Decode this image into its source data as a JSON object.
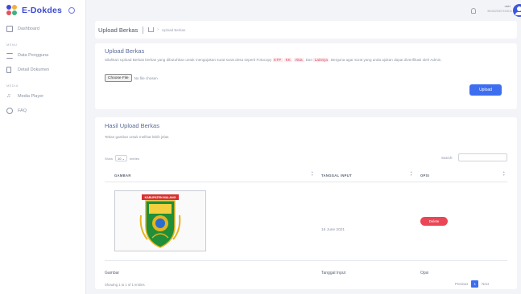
{
  "brand": {
    "title": "E-Dokdes"
  },
  "sidebar": {
    "items": [
      {
        "label": "Dashboard",
        "icon": "monitor-icon"
      },
      {
        "label": "Data Pengguna",
        "icon": "list-icon"
      },
      {
        "label": "Detail Dokumen",
        "icon": "document-icon"
      },
      {
        "label": "Media Player",
        "icon": "music-icon"
      },
      {
        "label": "FAQ",
        "icon": "help-icon"
      }
    ]
  },
  "header": {
    "user_name": "user",
    "user_id": "3515220307190011"
  },
  "breadcrumb": {
    "title": "Upload Berkas",
    "current": "Upload Berkas"
  },
  "upload": {
    "title": "Upload Berkas",
    "desc_before": "Silahkan Upload Berkas berkas yang dibutuhkan untuk mengajukan surat surat desa seperti Fotocopy ",
    "code1": "KTP",
    "sep1": ", ",
    "code2": "KK",
    "sep2": ", ",
    "code3": "Akta",
    "desc_mid": ", Dan ",
    "code4": "Lainnya",
    "desc_after": ". Berguna agar surat yang anda ajukan dapat diverifikasi oleh Admin.",
    "choose_file": "Choose File",
    "no_file": "No file chosen",
    "button": "Upload"
  },
  "results": {
    "title": "Hasil Upload Berkas",
    "hint": "Tekan gambar untuk melihat lebih jelas",
    "show_label": "Show",
    "entries_value": "10",
    "entries_label": "entries",
    "search_label": "Search:",
    "columns": [
      "GAMBAR",
      "TANGGAL INPUT",
      "OPSI"
    ],
    "rows": [
      {
        "date": "16 June 2021",
        "action": "Delete"
      }
    ],
    "footer_columns": [
      "Gambar",
      "Tanggal Input",
      "Opsi"
    ],
    "info": "Showing 1 to 1 of 1 entries",
    "prev": "Previous",
    "page": "1",
    "next": "Next"
  },
  "logo": {
    "banner_text": "KABUPATEN MALANG"
  },
  "colors": {
    "brand": "#3b4bd6",
    "primary": "#3d6ef0",
    "danger": "#ea4656"
  }
}
